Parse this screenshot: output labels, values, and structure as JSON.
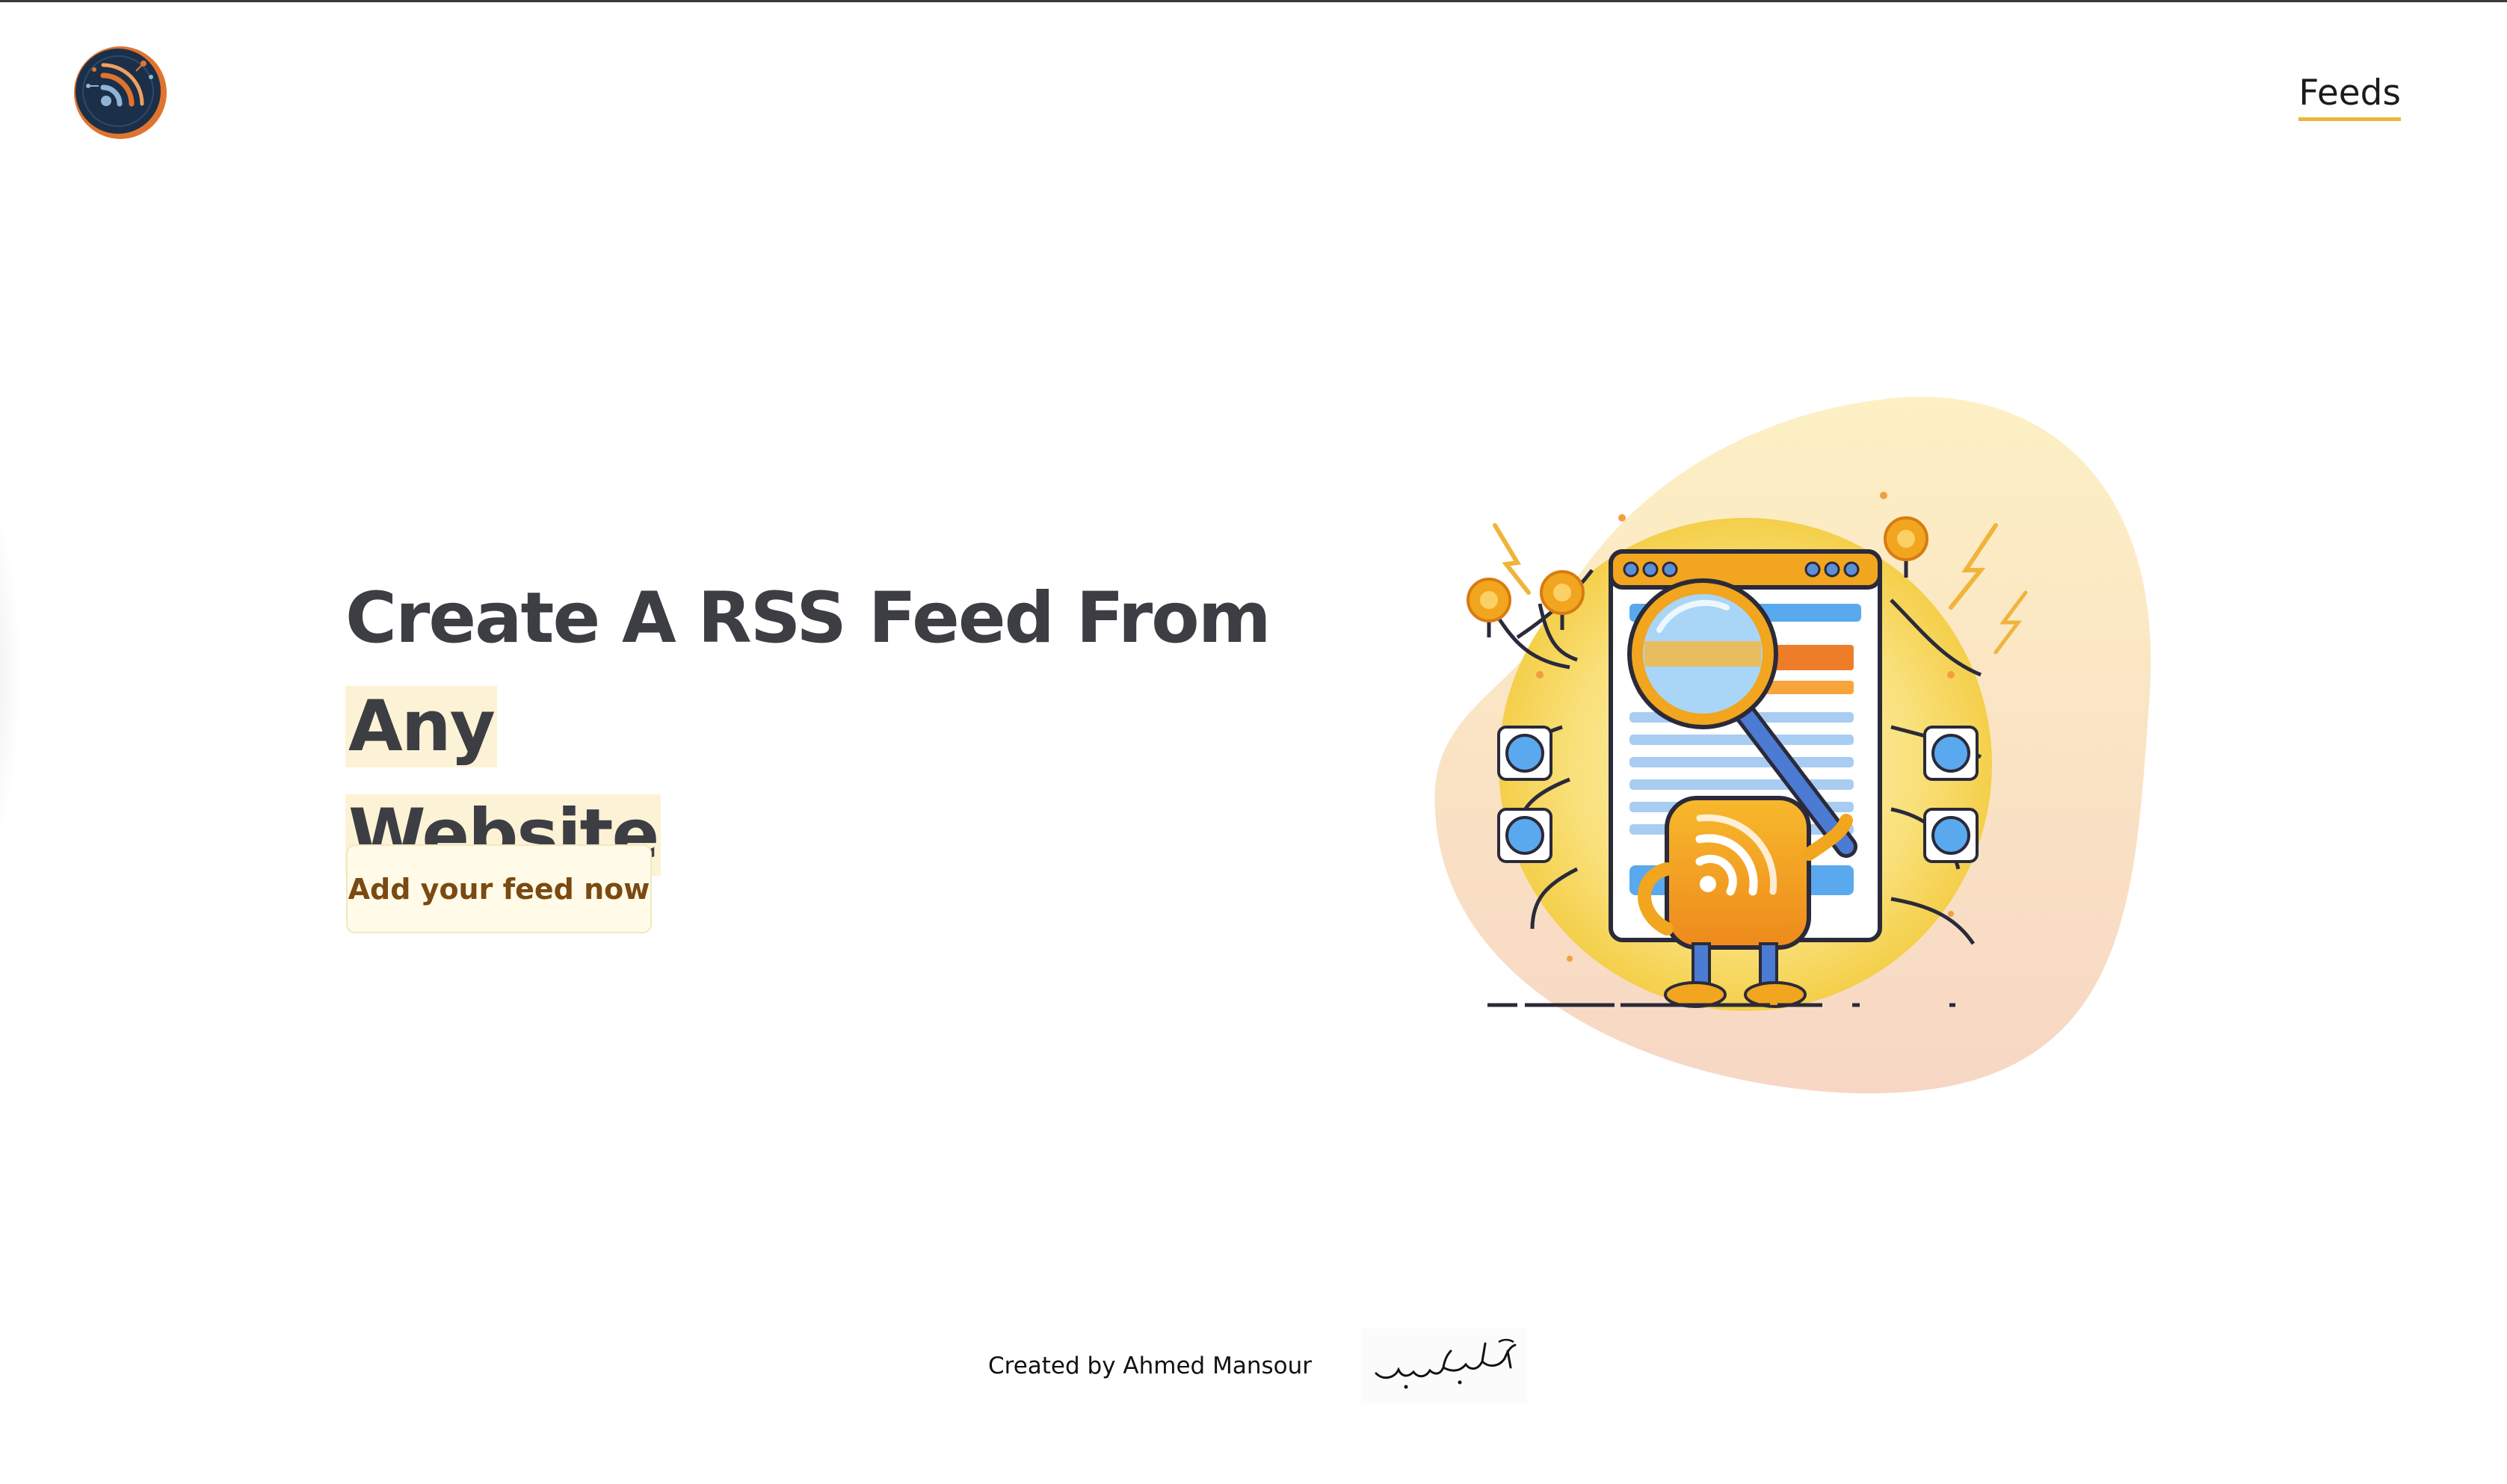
{
  "header": {
    "logo_icon": "rss-logo-icon",
    "nav_feeds_label": "Feeds"
  },
  "hero": {
    "title_part1": "Create A RSS Feed From ",
    "title_highlight1": "Any",
    "title_highlight2": "Website",
    "cta_label": "Add your feed now",
    "illustration": "rss-robot-magnifier-illustration"
  },
  "footer": {
    "credit_text": "Created by Ahmed Mansour",
    "signature_text": "أحمد منصور"
  },
  "colors": {
    "accent": "#f0b43a",
    "highlight": "#fcf3d6",
    "title": "#3d3e44",
    "cta_text": "#7a4a12",
    "cta_bg": "#fffbe8"
  }
}
